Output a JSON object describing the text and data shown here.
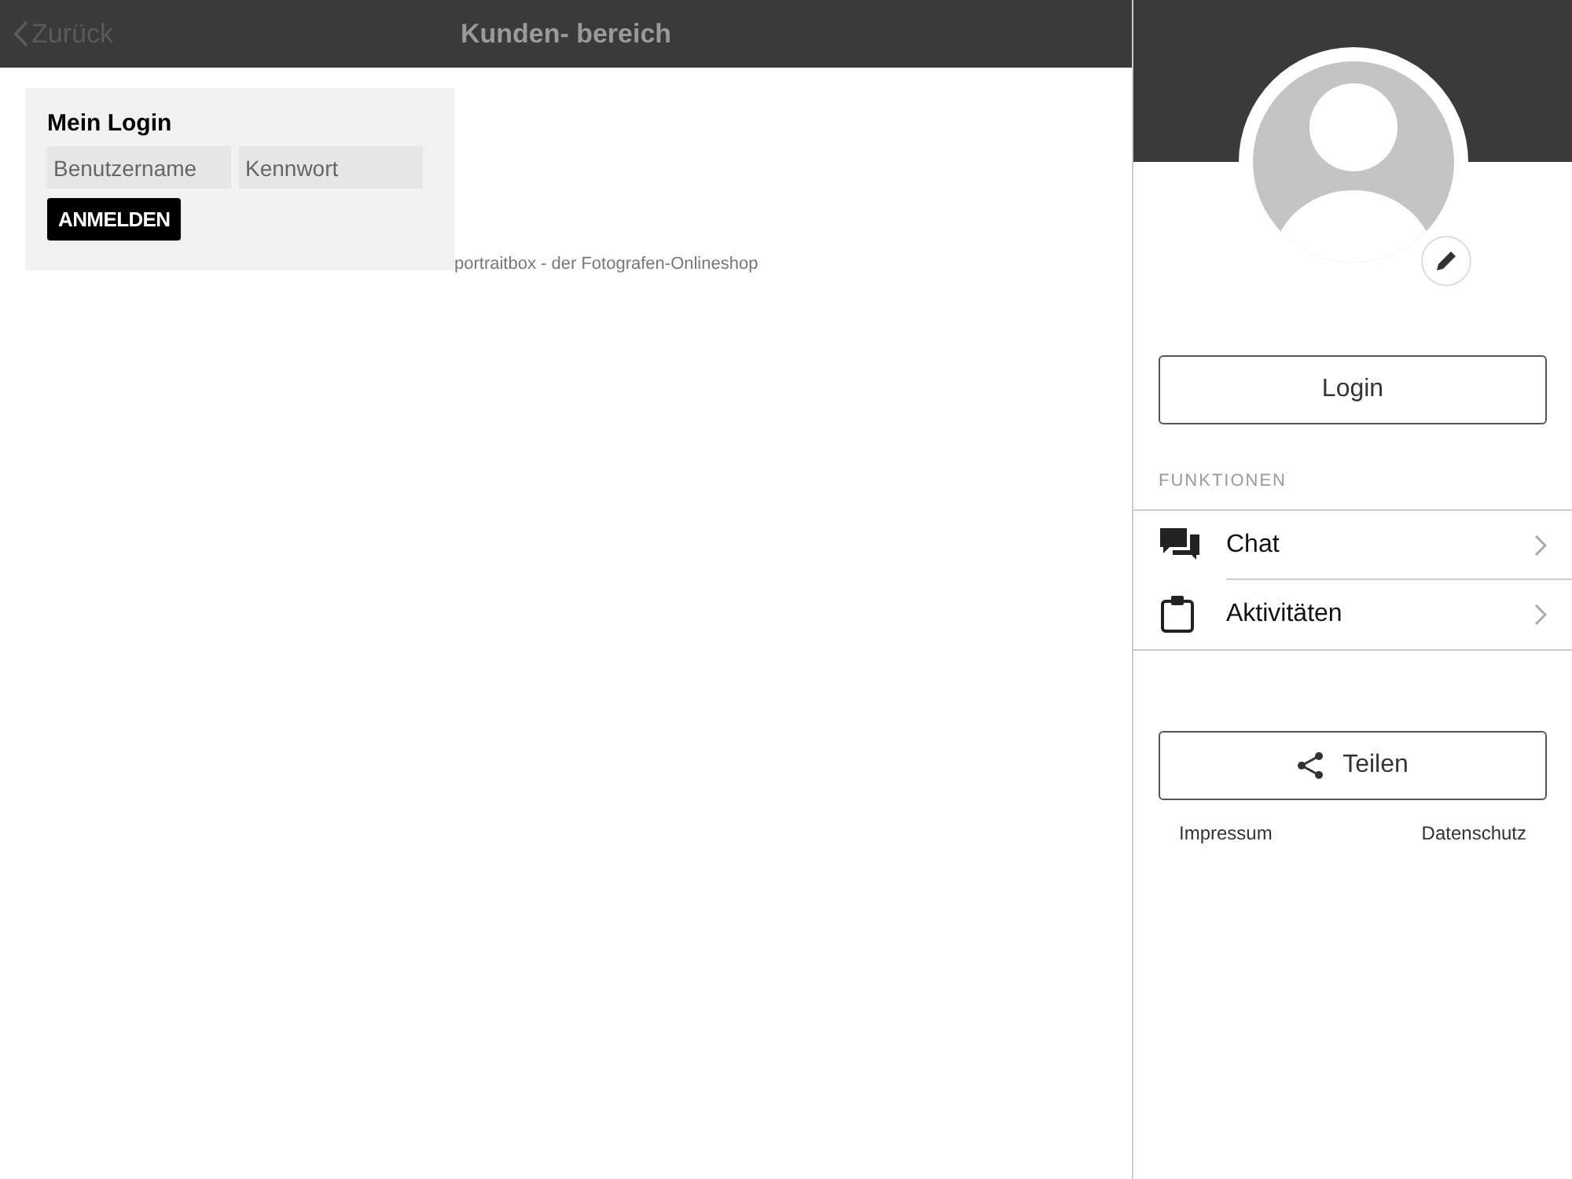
{
  "nav": {
    "back": "Zurück",
    "title": "Kunden- bereich"
  },
  "login_card": {
    "title": "Mein Login",
    "username": {
      "placeholder": "Benutzername"
    },
    "password": {
      "placeholder": "Kennwort"
    },
    "submit": "ANMELDEN"
  },
  "footer_text": "portraitbox - der Fotografen-Onlineshop",
  "sidebar": {
    "login_button": "Login",
    "section_title": "FUNKTIONEN",
    "items": [
      {
        "kind": "chat",
        "label": "Chat"
      },
      {
        "kind": "activities",
        "label": "Aktivitäten"
      }
    ],
    "share_button": "Teilen",
    "links": [
      "Impressum",
      "Datenschutz"
    ]
  }
}
